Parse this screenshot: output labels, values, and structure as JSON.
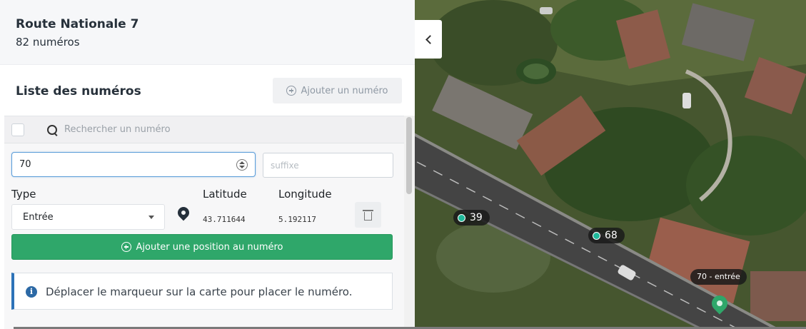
{
  "street": {
    "name": "Route Nationale 7",
    "count": "82 numéros"
  },
  "list": {
    "title": "Liste des numéros",
    "add_button": "Ajouter un numéro"
  },
  "search": {
    "placeholder": "Rechercher un numéro"
  },
  "form": {
    "number_value": "70",
    "suffix_placeholder": "suffixe",
    "type_label": "Type",
    "latitude_label": "Latitude",
    "longitude_label": "Longitude",
    "type_value": "Entrée",
    "latitude_value": "43.711644",
    "longitude_value": "5.192117",
    "add_position_button": "Ajouter une position au numéro"
  },
  "alert": {
    "text": "Déplacer le marqueur sur la carte pour placer le numéro."
  },
  "map": {
    "labels": [
      "39",
      "68"
    ],
    "entry_label": "70 - entrée"
  },
  "colors": {
    "primary_green": "#2fa76a",
    "info_blue": "#2d73b8",
    "marker_teal": "#1fb89a"
  },
  "icons": [
    "plus-circle-icon",
    "search-icon",
    "map-pin-icon",
    "trash-icon",
    "info-icon",
    "chevron-left-icon"
  ]
}
